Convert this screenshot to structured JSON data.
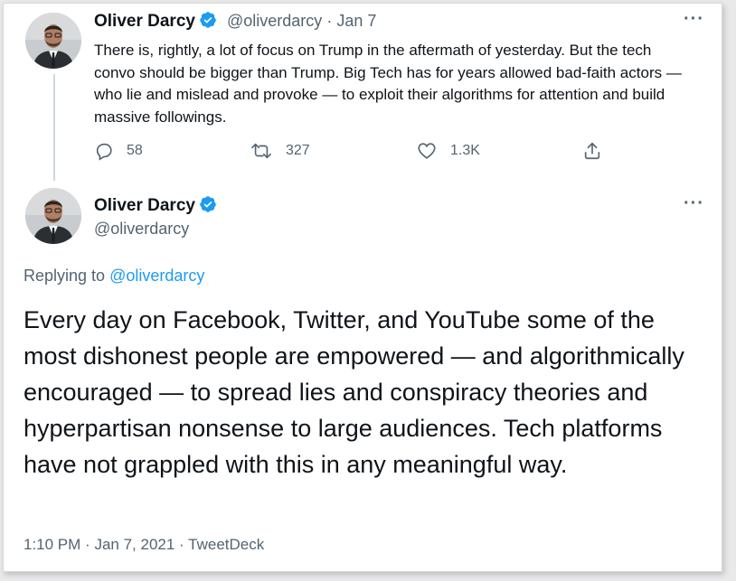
{
  "tweet1": {
    "author_name": "Oliver Darcy",
    "handle": "@oliverdarcy",
    "separator": "·",
    "date": "Jan 7",
    "text": "There is, rightly, a lot of focus on Trump in the aftermath of yesterday. But the tech convo should be bigger than Trump. Big Tech has for years allowed bad-faith actors — who lie and mislead and provoke — to exploit their algorithms for attention and build massive followings.",
    "replies": "58",
    "retweets": "327",
    "likes": "1.3K",
    "more_label": "···"
  },
  "tweet2": {
    "author_name": "Oliver Darcy",
    "handle": "@oliverdarcy",
    "replying_prefix": "Replying to",
    "replying_to": "@oliverdarcy",
    "text": "Every day on Facebook, Twitter, and YouTube some of the most dishonest people are empowered — and algorithmically encouraged — to spread lies and conspiracy theories and hyperpartisan nonsense to large audiences. Tech platforms have not grappled with this in any meaningful way.",
    "time": "1:10 PM",
    "separator": "·",
    "date": "Jan 7, 2021",
    "source": "TweetDeck",
    "more_label": "···"
  },
  "colors": {
    "accent": "#1d9bf0",
    "text": "#0f1419",
    "muted": "#536471",
    "thread_line": "#cfd9de"
  },
  "icons": {
    "verified": "verified-badge-icon",
    "reply": "reply-icon",
    "retweet": "retweet-icon",
    "like": "heart-icon",
    "share": "share-icon",
    "more": "more-icon"
  }
}
